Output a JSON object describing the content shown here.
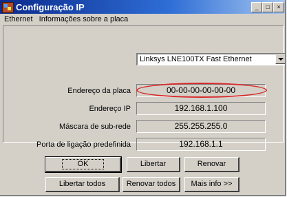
{
  "window": {
    "title": "Configuração IP",
    "minimize_label": "_",
    "maximize_label": "□",
    "close_label": "×"
  },
  "menubar": {
    "items": [
      "Ethernet",
      "Informações sobre a placa"
    ]
  },
  "adapter": {
    "selected": "Linksys LNE100TX Fast Ethernet"
  },
  "fields": {
    "mac_label": "Endereço da placa",
    "mac_value": "00-00-00-00-00-00",
    "ip_label": "Endereço IP",
    "ip_value": "192.168.1.100",
    "mask_label": "Máscara de sub-rede",
    "mask_value": "255.255.255.0",
    "gateway_label": "Porta de ligação predefinida",
    "gateway_value": "192.168.1.1"
  },
  "buttons": {
    "ok": "OK",
    "release": "Libertar",
    "renew": "Renovar",
    "release_all": "Libertar todos",
    "renew_all": "Renovar todos",
    "more_info": "Mais info >>"
  },
  "highlight_color": "#d8282a"
}
